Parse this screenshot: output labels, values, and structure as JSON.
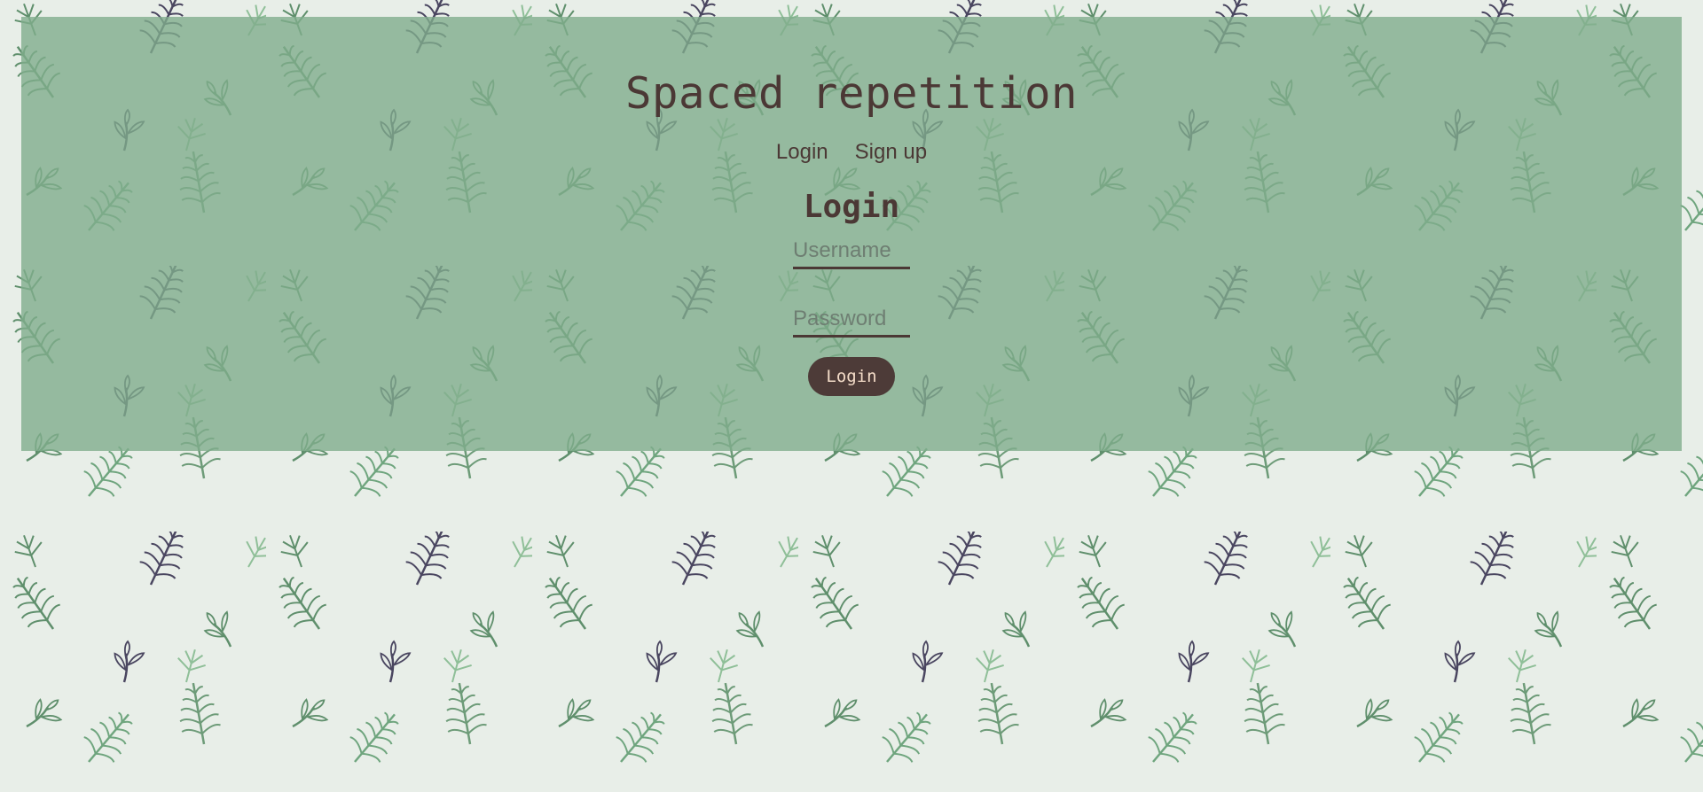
{
  "header": {
    "title": "Spaced repetition",
    "nav": [
      {
        "label": "Login"
      },
      {
        "label": "Sign up"
      }
    ]
  },
  "login_form": {
    "title": "Login",
    "username": {
      "value": "",
      "placeholder": "Username"
    },
    "password": {
      "value": "",
      "placeholder": "Password"
    },
    "submit_label": "Login"
  },
  "colors": {
    "page_background": "#e8eee8",
    "panel": "#80ac8c",
    "text": "#4b3835",
    "button": "#4d3b38",
    "button_text": "#f4dcc8",
    "leaf_green": "#5f8f6c",
    "leaf_light": "#8fbf98",
    "leaf_dark": "#4a4660"
  }
}
